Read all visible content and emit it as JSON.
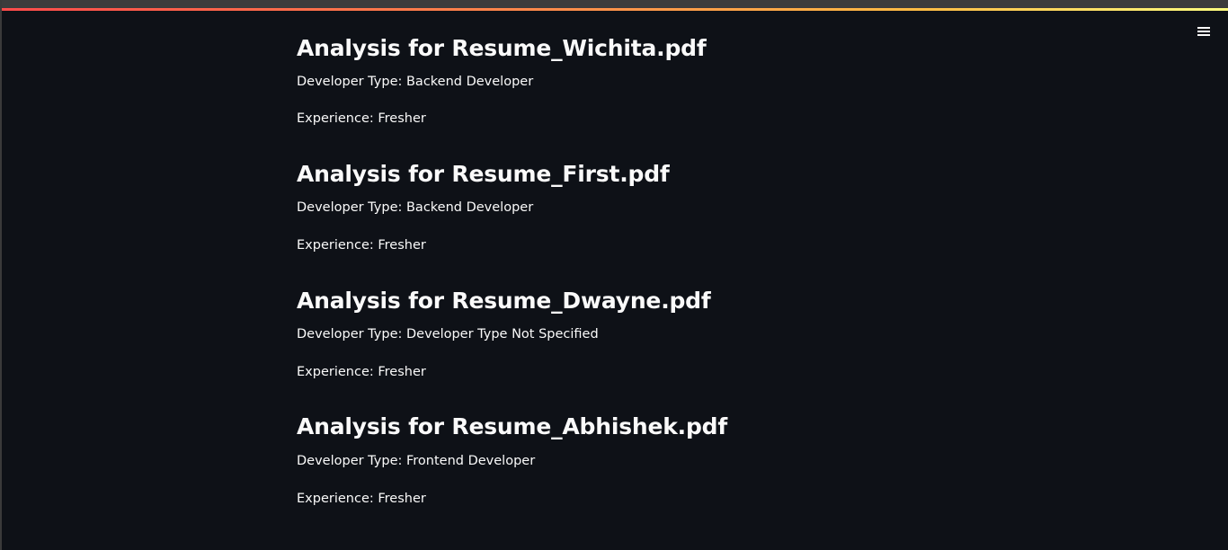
{
  "analyses": [
    {
      "title": "Analysis for Resume_Wichita.pdf",
      "developer_type": "Developer Type: Backend Developer",
      "experience": "Experience: Fresher"
    },
    {
      "title": "Analysis for Resume_First.pdf",
      "developer_type": "Developer Type: Backend Developer",
      "experience": "Experience: Fresher"
    },
    {
      "title": "Analysis for Resume_Dwayne.pdf",
      "developer_type": "Developer Type: Developer Type Not Specified",
      "experience": "Experience: Fresher"
    },
    {
      "title": "Analysis for Resume_Abhishek.pdf",
      "developer_type": "Developer Type: Frontend Developer",
      "experience": "Experience: Fresher"
    }
  ],
  "icons": {
    "menu": "hamburger-menu-icon"
  },
  "colors": {
    "background": "#0e1117",
    "text": "#fafafa",
    "accent_start": "#ff4b4b",
    "accent_end": "#fffd80"
  }
}
